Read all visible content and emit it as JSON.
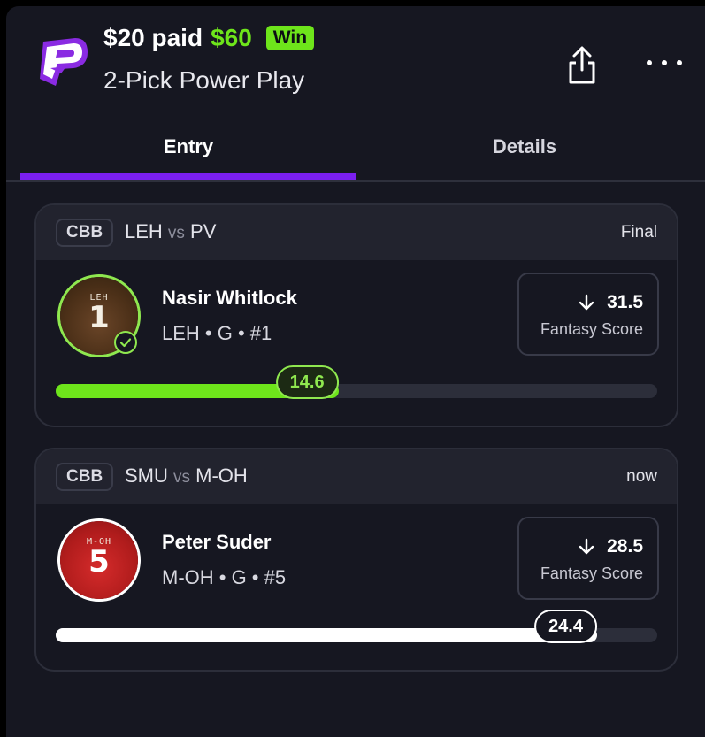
{
  "header": {
    "paid_text": "$20 paid",
    "payout_text": "$60",
    "result_badge": "Win",
    "subtitle": "2-Pick Power Play",
    "share_icon": "share-icon",
    "more_icon": "more-horizontal-icon"
  },
  "tabs": [
    {
      "label": "Entry",
      "active": true
    },
    {
      "label": "Details",
      "active": false
    }
  ],
  "picks": [
    {
      "league": "CBB",
      "team_a": "LEH",
      "vs": "vs",
      "team_b": "PV",
      "status": "Final",
      "player_name": "Nasir Whitlock",
      "player_meta": "LEH • G • #1",
      "jersey_team": "LEH",
      "jersey_number": "1",
      "direction_icon": "arrow-down-icon",
      "line": "31.5",
      "stat_label": "Fantasy Score",
      "current_value": "14.6",
      "progress_fraction": 0.47,
      "result_icon": "check-icon"
    },
    {
      "league": "CBB",
      "team_a": "SMU",
      "vs": "vs",
      "team_b": "M-OH",
      "status": "now",
      "player_name": "Peter Suder",
      "player_meta": "M-OH • G • #5",
      "jersey_team": "M-OH",
      "jersey_number": "5",
      "direction_icon": "arrow-down-icon",
      "line": "28.5",
      "stat_label": "Fantasy Score",
      "current_value": "24.4",
      "progress_fraction": 0.9
    }
  ],
  "colors": {
    "accent_green": "#6ee51b",
    "tab_indicator": "#7b1ff0",
    "background": "#161721"
  }
}
